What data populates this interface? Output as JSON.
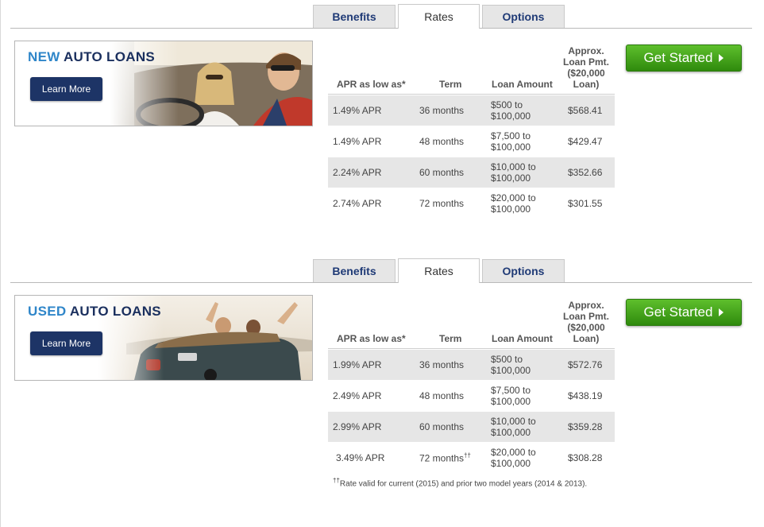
{
  "tabs": [
    "Benefits",
    "Rates",
    "Options"
  ],
  "headers": {
    "apr": "APR as low as*",
    "term": "Term",
    "amount": "Loan Amount",
    "pmt_lines": [
      "Approx.",
      "Loan Pmt.",
      "($20,000",
      "Loan)"
    ]
  },
  "cta_label": "Get Started",
  "new_loans": {
    "title_accent": "NEW",
    "title_rest": "AUTO LOANS",
    "learn_more": "Learn More",
    "rows": [
      {
        "apr": "1.49% APR",
        "term": "36 months",
        "amount_1": "$500 to",
        "amount_2": "$100,000",
        "pmt": "$568.41"
      },
      {
        "apr": "1.49% APR",
        "term": "48 months",
        "amount_1": "$7,500 to",
        "amount_2": "$100,000",
        "pmt": "$429.47"
      },
      {
        "apr": "2.24% APR",
        "term": "60 months",
        "amount_1": "$10,000 to",
        "amount_2": "$100,000",
        "pmt": "$352.66"
      },
      {
        "apr": "2.74% APR",
        "term": "72 months",
        "amount_1": "$20,000 to",
        "amount_2": "$100,000",
        "pmt": "$301.55"
      }
    ]
  },
  "used_loans": {
    "title_accent": "USED",
    "title_rest": "AUTO LOANS",
    "learn_more": "Learn More",
    "rows": [
      {
        "apr": "1.99% APR",
        "term": "36 months",
        "amount_1": "$500 to",
        "amount_2": "$100,000",
        "pmt": "$572.76"
      },
      {
        "apr": "2.49% APR",
        "term": "48 months",
        "amount_1": "$7,500 to",
        "amount_2": "$100,000",
        "pmt": "$438.19"
      },
      {
        "apr": "2.99% APR",
        "term": "60 months",
        "amount_1": "$10,000 to",
        "amount_2": "$100,000",
        "pmt": "$359.28"
      },
      {
        "apr": "3.49% APR",
        "term": "72 months",
        "term_mark": "††",
        "amount_1": "$20,000 to",
        "amount_2": "$100,000",
        "pmt": "$308.28"
      }
    ],
    "footnote_mark": "††",
    "footnote": "Rate valid for current (2015) and prior two model years (2014 & 2013)."
  },
  "colors": {
    "navy": "#1d3466",
    "accent_blue": "#2f86c9",
    "cta_green": "#3f9e18",
    "tab_text": "#1f3a76"
  }
}
